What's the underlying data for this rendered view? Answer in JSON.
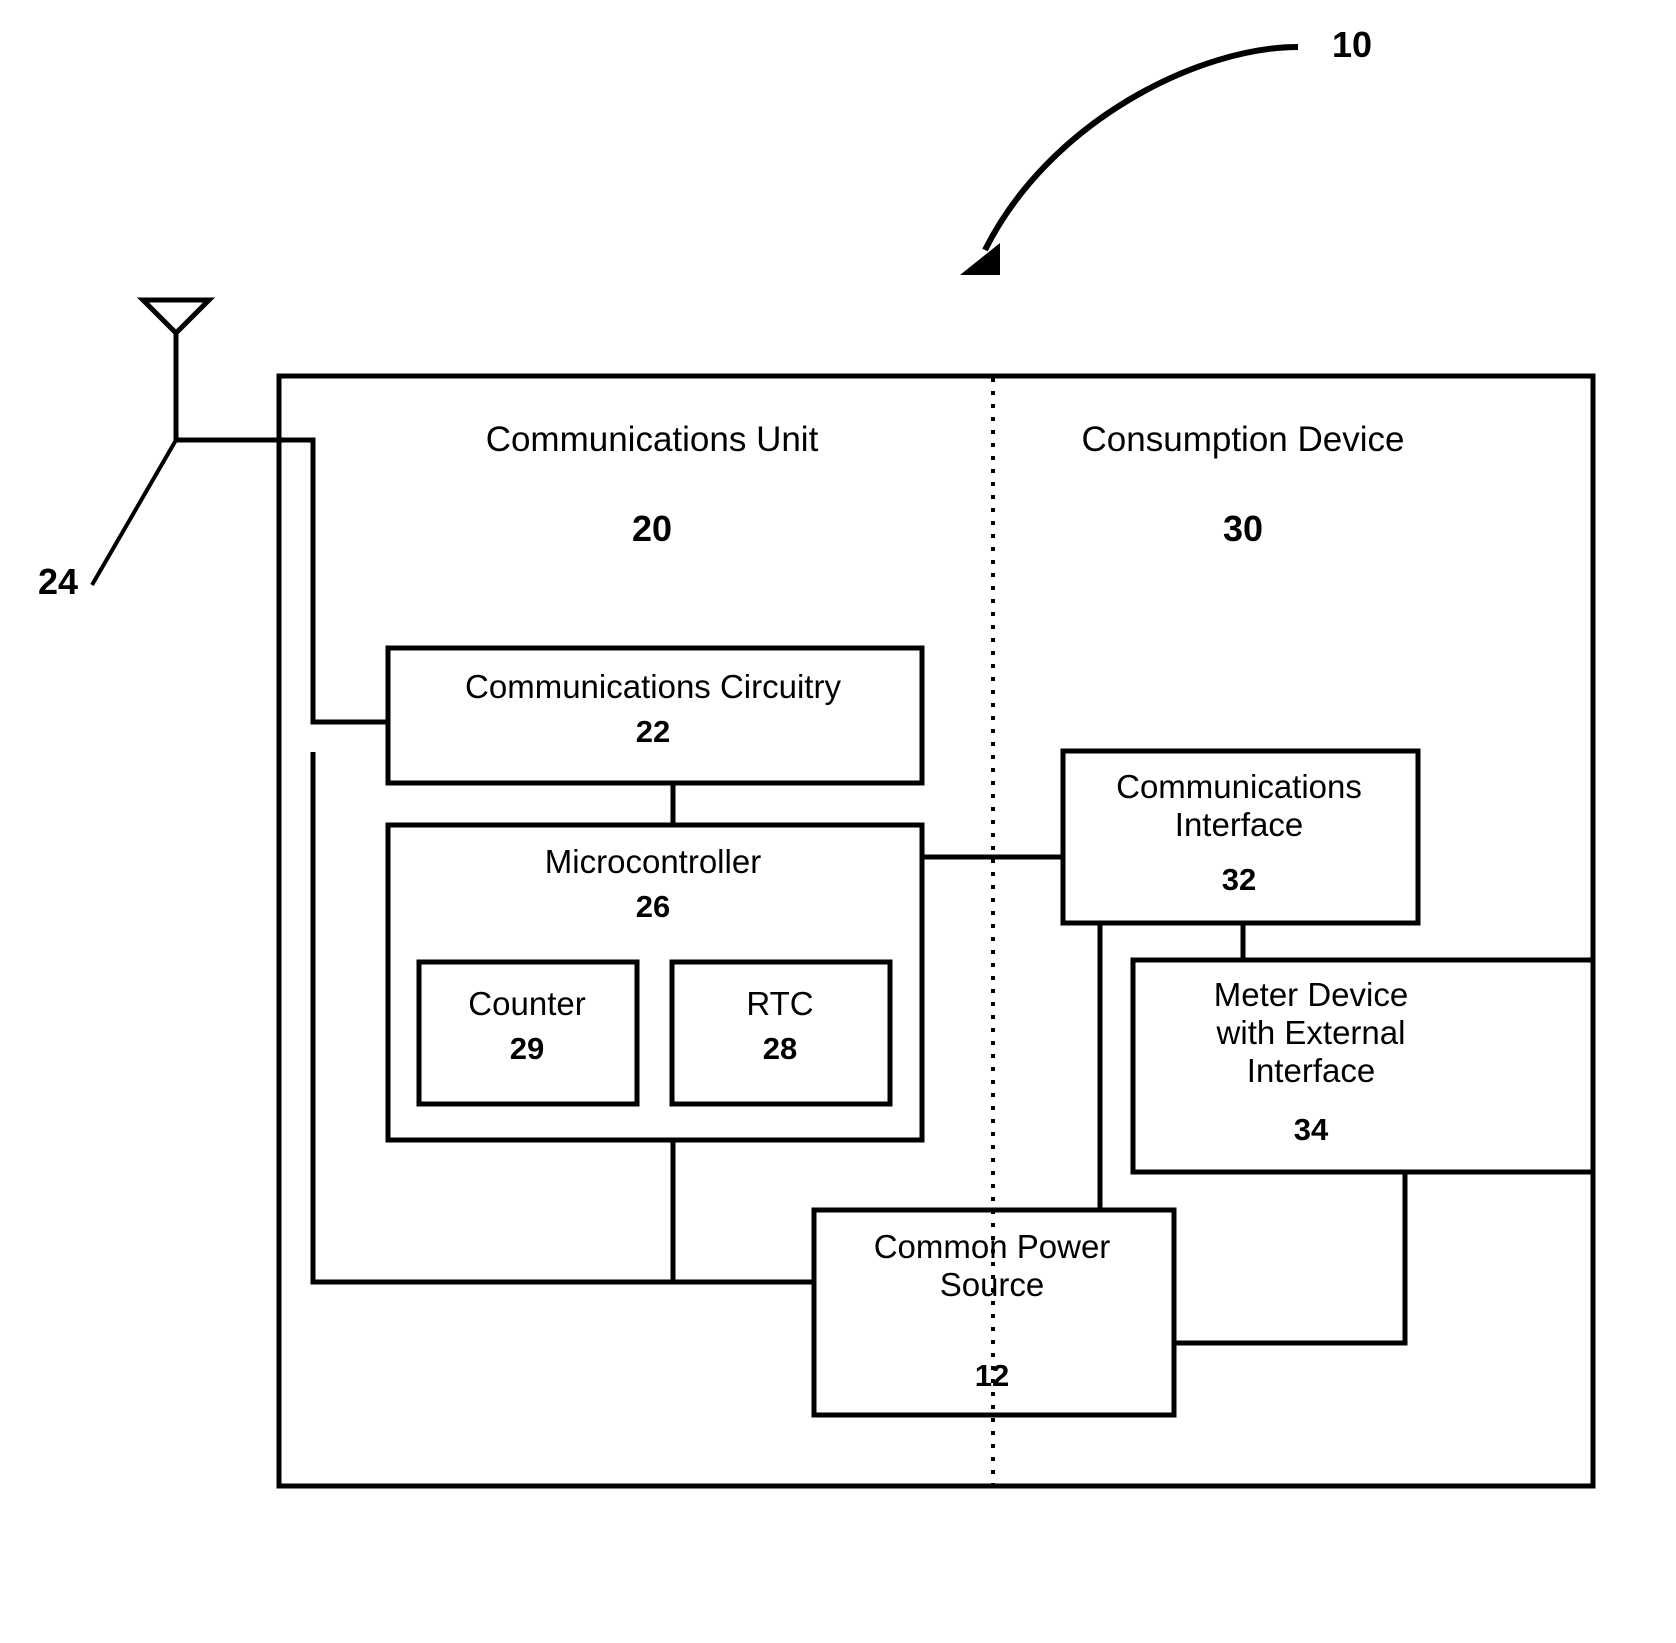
{
  "figure": {
    "reference_label": "10",
    "antenna_label": "24"
  },
  "sections": [
    {
      "name": "communications-unit",
      "title": "Communications Unit",
      "ref": "20"
    },
    {
      "name": "consumption-device",
      "title": "Consumption Device",
      "ref": "30"
    }
  ],
  "blocks": [
    {
      "name": "communications-circuitry",
      "label": "Communications Circuitry",
      "ref": "22"
    },
    {
      "name": "microcontroller",
      "label": "Microcontroller",
      "ref": "26"
    },
    {
      "name": "counter",
      "label": "Counter",
      "ref": "29"
    },
    {
      "name": "rtc",
      "label": "RTC",
      "ref": "28"
    },
    {
      "name": "communications-interface",
      "label": "Communications\nInterface",
      "ref": "32"
    },
    {
      "name": "meter-device",
      "label": "Meter Device\nwith External\nInterface",
      "ref": "34"
    },
    {
      "name": "common-power-source",
      "label": "Common Power\nSource",
      "ref": "12"
    }
  ],
  "colors": {
    "stroke": "#000000",
    "background": "#ffffff"
  }
}
